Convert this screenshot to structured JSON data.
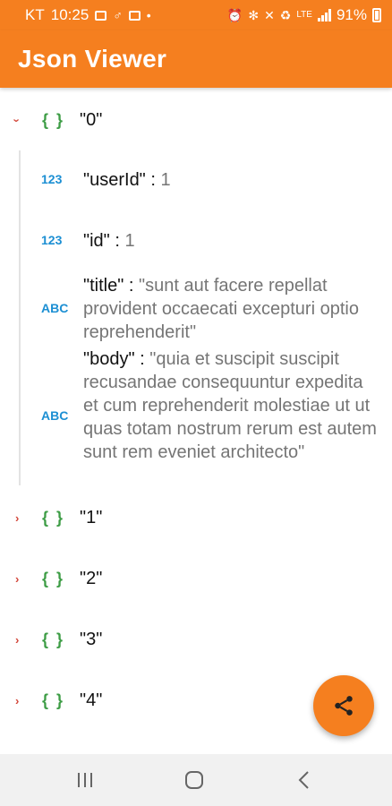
{
  "status_bar": {
    "carrier": "KT",
    "time": "10:25",
    "network": "LTE",
    "battery": "91%",
    "left_icons": [
      "image-icon",
      "notification-icon",
      "photo-icon",
      "dot-icon"
    ],
    "right_icons": [
      "alarm-icon",
      "bluetooth-icon",
      "mute-icon",
      "battery-saver-icon",
      "lte-icon",
      "signal-icon",
      "battery-icon"
    ]
  },
  "app_bar": {
    "title": "Json Viewer"
  },
  "tree": {
    "nodes": [
      {
        "key": "\"0\"",
        "expanded": true,
        "children": [
          {
            "type": "123",
            "key": "\"userId\"",
            "sep": " : ",
            "value": "1"
          },
          {
            "type": "123",
            "key": "\"id\"",
            "sep": " : ",
            "value": "1"
          },
          {
            "type": "ABC",
            "key": "\"title\"",
            "sep": " : ",
            "value": "\"sunt aut facere repellat provident occaecati excepturi optio reprehenderit\""
          },
          {
            "type": "ABC",
            "key": "\"body\"",
            "sep": " : ",
            "value": "\"quia et suscipit suscipit recusandae consequuntur expedita et cum reprehenderit molestiae ut ut quas totam nostrum rerum est autem sunt rem eveniet architecto\""
          }
        ]
      },
      {
        "key": "\"1\"",
        "expanded": false
      },
      {
        "key": "\"2\"",
        "expanded": false
      },
      {
        "key": "\"3\"",
        "expanded": false
      },
      {
        "key": "\"4\"",
        "expanded": false
      }
    ],
    "object_icon_text": "{ }",
    "chevron_collapsed": "›"
  },
  "fab": {
    "icon": "share-icon"
  },
  "nav_bar": {
    "buttons": [
      "recents-button",
      "home-button",
      "back-button"
    ]
  },
  "colors": {
    "accent": "#f57f1f",
    "chevron": "#d3473b",
    "object_icon": "#3e9d46",
    "type_badge": "#1c8fd3",
    "value_text": "#757575"
  }
}
